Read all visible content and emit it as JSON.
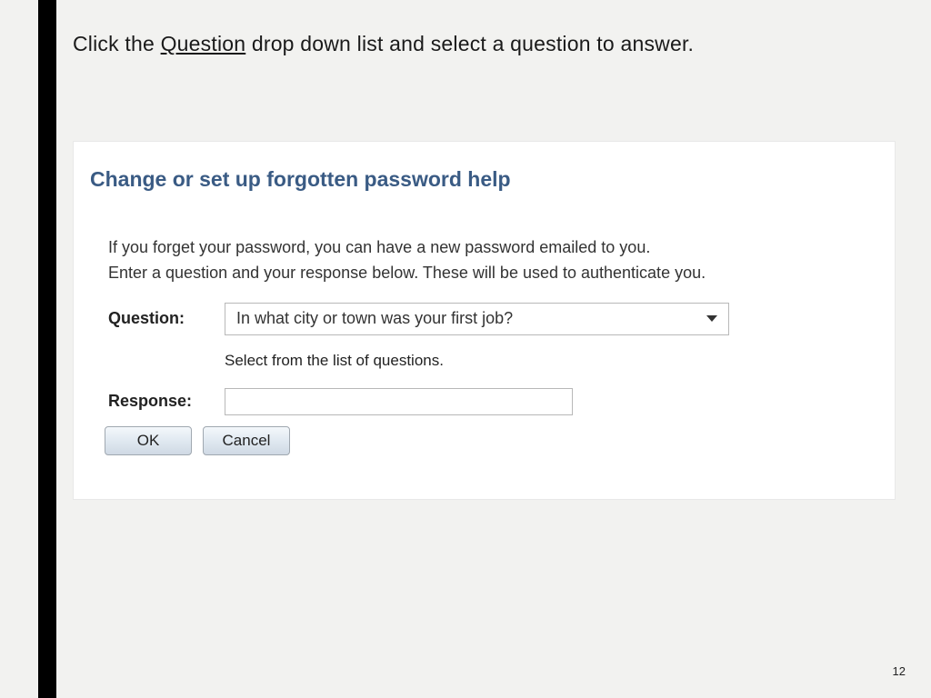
{
  "instruction": {
    "prefix": "Click the ",
    "underlined": "Question",
    "suffix": " drop down list and select a question to answer."
  },
  "panel": {
    "title": "Change or set up forgotten password help",
    "info_line_1": "If you forget your password, you can have a new password emailed to you.",
    "info_line_2": "Enter a question and your response below. These will be used to authenticate you.",
    "question_label": "Question:",
    "question_value": "In what city or town was your first job?",
    "helper_text": "Select from the list of questions.",
    "response_label": "Response:",
    "response_value": "",
    "ok_label": "OK",
    "cancel_label": "Cancel"
  },
  "page_number": "12"
}
